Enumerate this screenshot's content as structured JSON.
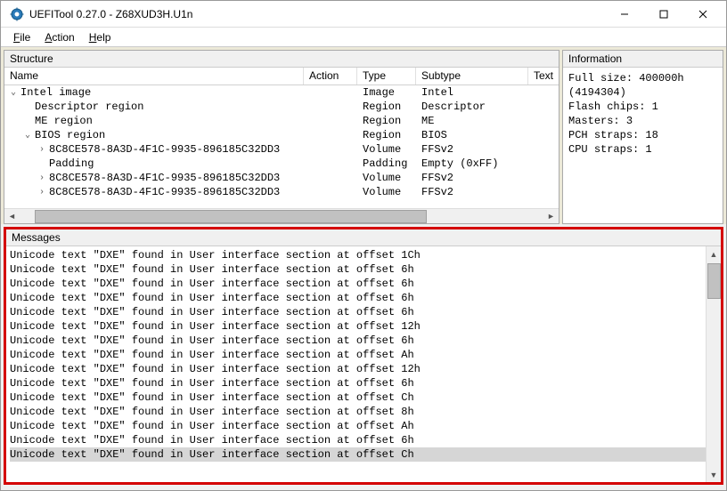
{
  "window": {
    "title": "UEFITool 0.27.0 - Z68XUD3H.U1n"
  },
  "menubar": {
    "file": "File",
    "action": "Action",
    "help": "Help"
  },
  "panels": {
    "structure_label": "Structure",
    "information_label": "Information",
    "messages_label": "Messages"
  },
  "columns": {
    "name": "Name",
    "action": "Action",
    "type": "Type",
    "subtype": "Subtype",
    "text": "Text"
  },
  "tree": [
    {
      "indent": 0,
      "expander": "v",
      "name": "Intel image",
      "action": "",
      "type": "Image",
      "subtype": "Intel"
    },
    {
      "indent": 1,
      "expander": "",
      "name": "Descriptor region",
      "action": "",
      "type": "Region",
      "subtype": "Descriptor"
    },
    {
      "indent": 1,
      "expander": "",
      "name": "ME region",
      "action": "",
      "type": "Region",
      "subtype": "ME"
    },
    {
      "indent": 1,
      "expander": "v",
      "name": "BIOS region",
      "action": "",
      "type": "Region",
      "subtype": "BIOS"
    },
    {
      "indent": 2,
      "expander": ">",
      "name": "8C8CE578-8A3D-4F1C-9935-896185C32DD3",
      "action": "",
      "type": "Volume",
      "subtype": "FFSv2"
    },
    {
      "indent": 2,
      "expander": "",
      "name": "Padding",
      "action": "",
      "type": "Padding",
      "subtype": "Empty (0xFF)"
    },
    {
      "indent": 2,
      "expander": ">",
      "name": "8C8CE578-8A3D-4F1C-9935-896185C32DD3",
      "action": "",
      "type": "Volume",
      "subtype": "FFSv2"
    },
    {
      "indent": 2,
      "expander": ">",
      "name": "8C8CE578-8A3D-4F1C-9935-896185C32DD3",
      "action": "",
      "type": "Volume",
      "subtype": "FFSv2"
    }
  ],
  "info": {
    "full_size": "Full size: 400000h",
    "full_size_dec": "(4194304)",
    "flash_chips": "Flash chips: 1",
    "masters": "Masters: 3",
    "pch_straps": "PCH straps: 18",
    "cpu_straps": "CPU straps: 1"
  },
  "messages": [
    "Unicode text \"DXE\" found in User interface section at offset 1Ch",
    "Unicode text \"DXE\" found in User interface section at offset 6h",
    "Unicode text \"DXE\" found in User interface section at offset 6h",
    "Unicode text \"DXE\" found in User interface section at offset 6h",
    "Unicode text \"DXE\" found in User interface section at offset 6h",
    "Unicode text \"DXE\" found in User interface section at offset 12h",
    "Unicode text \"DXE\" found in User interface section at offset 6h",
    "Unicode text \"DXE\" found in User interface section at offset Ah",
    "Unicode text \"DXE\" found in User interface section at offset 12h",
    "Unicode text \"DXE\" found in User interface section at offset 6h",
    "Unicode text \"DXE\" found in User interface section at offset Ch",
    "Unicode text \"DXE\" found in User interface section at offset 8h",
    "Unicode text \"DXE\" found in User interface section at offset Ah",
    "Unicode text \"DXE\" found in User interface section at offset 6h",
    "Unicode text \"DXE\" found in User interface section at offset Ch"
  ],
  "messages_selected_index": 14
}
